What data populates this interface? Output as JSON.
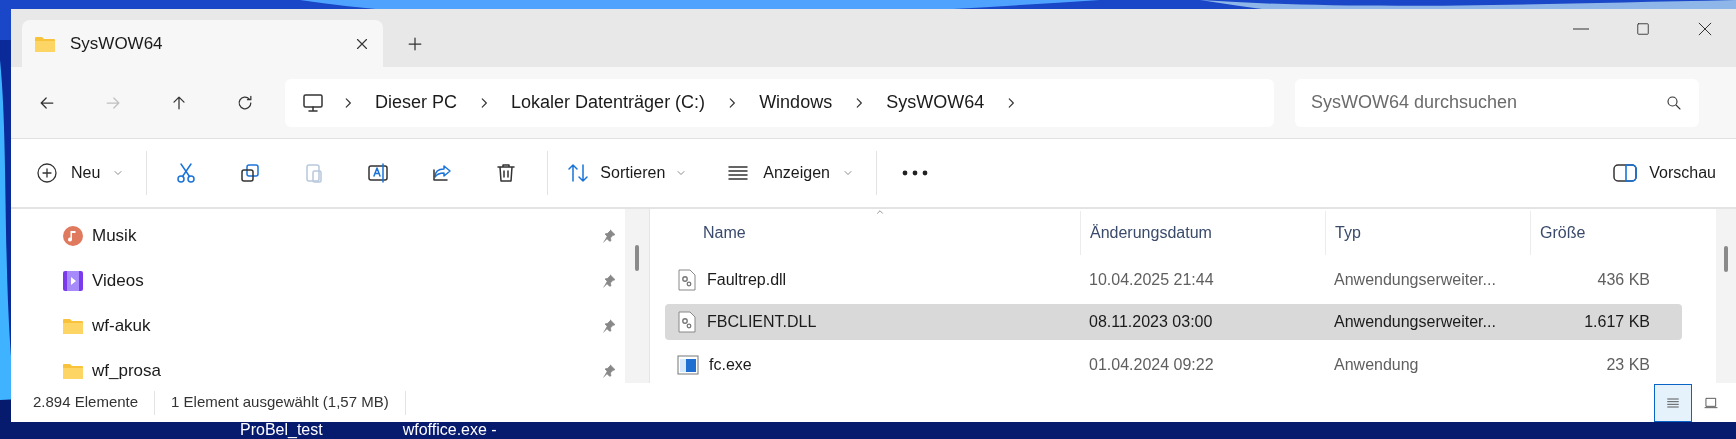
{
  "tab": {
    "title": "SysWOW64",
    "selected": true
  },
  "nav": {
    "back_disabled": false,
    "forward_disabled": true
  },
  "breadcrumb": [
    "Dieser PC",
    "Lokaler Datenträger (C:)",
    "Windows",
    "SysWOW64"
  ],
  "search": {
    "placeholder": "SysWOW64 durchsuchen"
  },
  "toolbar": {
    "new_label": "Neu",
    "sort_label": "Sortieren",
    "view_label": "Anzeigen",
    "preview_label": "Vorschau",
    "paste_disabled": true
  },
  "sidebar": {
    "items": [
      {
        "label": "Musik",
        "kind": "music"
      },
      {
        "label": "Videos",
        "kind": "videos"
      },
      {
        "label": "wf-akuk",
        "kind": "folder"
      },
      {
        "label": "wf_prosa",
        "kind": "folder"
      }
    ]
  },
  "table": {
    "columns": [
      {
        "label": "Name",
        "sorted": true
      },
      {
        "label": "Änderungsdatum",
        "sorted": false
      },
      {
        "label": "Typ",
        "sorted": false
      },
      {
        "label": "Größe",
        "sorted": false
      }
    ],
    "rows": [
      {
        "name": "Faultrep.dll",
        "date": "10.04.2025 21:44",
        "type": "Anwendungserweiter...",
        "size": "436 KB",
        "kind": "dll",
        "selected": false
      },
      {
        "name": "FBCLIENT.DLL",
        "date": "08.11.2023 03:00",
        "type": "Anwendungserweiter...",
        "size": "1.617 KB",
        "kind": "dll",
        "selected": true
      },
      {
        "name": "fc.exe",
        "date": "01.04.2024 09:22",
        "type": "Anwendung",
        "size": "23 KB",
        "kind": "exe",
        "selected": false
      }
    ]
  },
  "status_bar": {
    "count": "2.894 Elemente",
    "selection": "1 Element ausgewählt (1,57 MB)",
    "views": [
      {
        "kind": "details",
        "selected": true
      },
      {
        "kind": "tiles",
        "selected": false
      }
    ]
  },
  "desktop_labels": [
    "ProBel_test",
    "wfoffice.exe -"
  ]
}
